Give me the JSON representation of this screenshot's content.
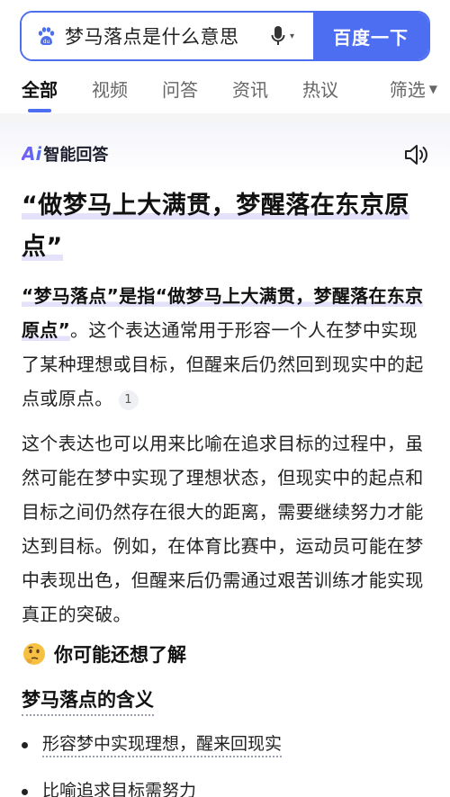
{
  "search": {
    "query": "梦马落点是什么意思",
    "button_label": "百度一下"
  },
  "tabs": [
    {
      "label": "全部",
      "active": true
    },
    {
      "label": "视频",
      "active": false
    },
    {
      "label": "问答",
      "active": false
    },
    {
      "label": "资讯",
      "active": false
    },
    {
      "label": "热议",
      "active": false
    }
  ],
  "filter_label": "筛选",
  "ai": {
    "brand_mark": "Ai",
    "brand_label": "智能回答",
    "title_line1": "“做梦马上大满贯，梦醒落在东京原",
    "title_line2": "点”",
    "para1_bold": "“梦马落点”是指“做梦马上大满贯，梦醒落在东京原点”",
    "para1_rest": "。这个表达通常用于形容一个人在梦中实现了某种理想或目标，但醒来后仍然回到现实中的起点或原点。",
    "citation": "1",
    "para2": "这个表达也可以用来比喻在追求目标的过程中，虽然可能在梦中实现了理想状态，但现实中的起点和目标之间仍然存在很大的距离，需要继续努力才能达到目标。例如，在体育比赛中，运动员可能在梦中表现出色，但醒来后仍需通过艰苦训练才能实现真正的突破。"
  },
  "related": {
    "heading": "你可能还想了解",
    "subtitle": "梦马落点的含义",
    "items": [
      "形容梦中实现理想，醒来回现实",
      "比喻追求目标需努力"
    ]
  },
  "colors": {
    "accent": "#4e6ef2",
    "highlight": "#e4e2fa"
  }
}
